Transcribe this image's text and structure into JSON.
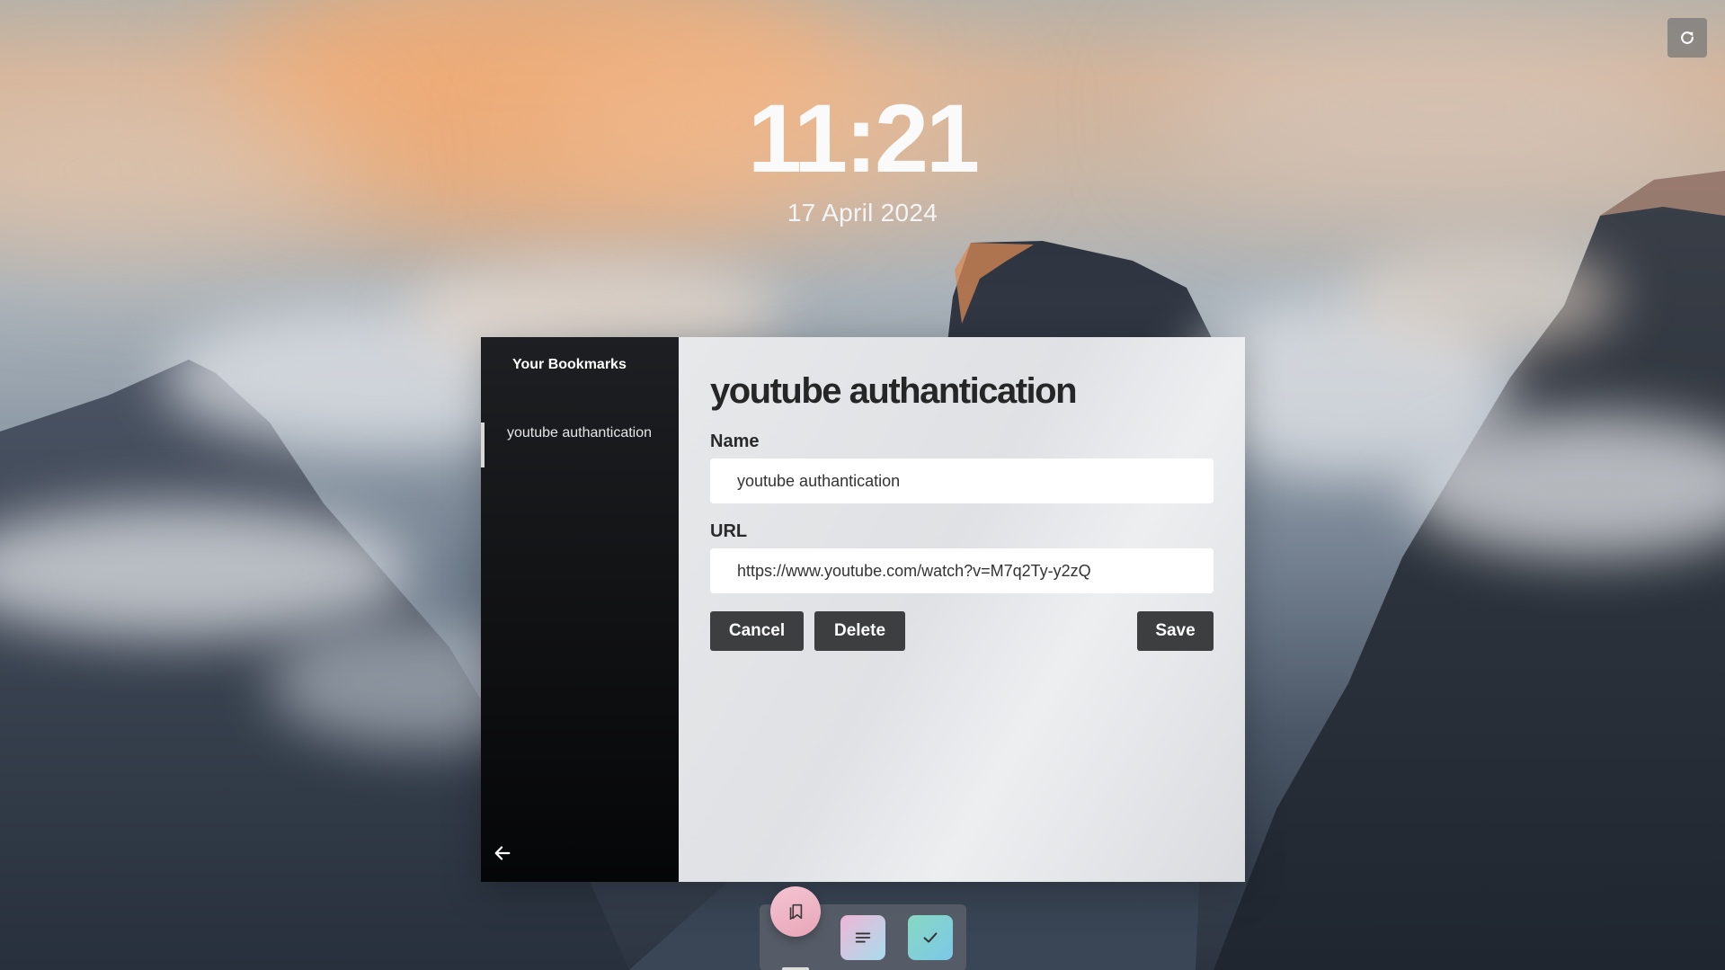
{
  "clock": {
    "time": "11:21",
    "date": "17 April 2024"
  },
  "top_right": {
    "icon": "refresh-icon"
  },
  "sidebar": {
    "title": "Your Bookmarks",
    "items": [
      {
        "label": "youtube authantication",
        "selected": true
      }
    ],
    "back_icon": "arrow-left-icon"
  },
  "editor": {
    "title": "youtube authantication",
    "name_label": "Name",
    "name_value": "youtube authantication",
    "url_label": "URL",
    "url_value": "https://www.youtube.com/watch?v=M7q2Ty-y2zQ",
    "cancel_label": "Cancel",
    "delete_label": "Delete",
    "save_label": "Save"
  },
  "dock": {
    "items": [
      {
        "icon": "bookmark-icon",
        "active": true
      },
      {
        "icon": "notes-icon"
      },
      {
        "icon": "check-icon"
      }
    ]
  }
}
